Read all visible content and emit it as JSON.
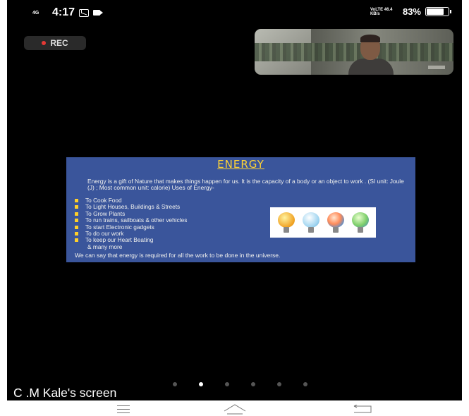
{
  "status_bar": {
    "network": "4G",
    "time": "4:17",
    "signal_text": "VoLTE 46.4 KB/s",
    "battery": "83%",
    "battery_level": 0.83
  },
  "rec_label": "REC",
  "slide": {
    "title": "ENERGY",
    "description": "Energy is a gift of Nature that makes things happen for us. It is the capacity of a body or an object to work . (SI unit: Joule (J) ; Most common unit: calorie)  Uses of Energy-",
    "uses": [
      "To Cook Food",
      "To Light Houses, Buildings & Streets",
      "To Grow Plants",
      "To run trains, sailboats & other vehicles",
      "To start Electronic gadgets",
      "To do our work",
      "To keep our Heart Beating"
    ],
    "more": "& many more",
    "conclusion": "We can say that energy is required for all the work to be done in the universe."
  },
  "page_indicator": {
    "count": 6,
    "active": 1
  },
  "presenter_label": "C .M Kale's screen",
  "colors": {
    "background": "#000000",
    "slide_bg": "#3a559b",
    "title": "#ffd335",
    "rec_dot": "#e53935"
  }
}
